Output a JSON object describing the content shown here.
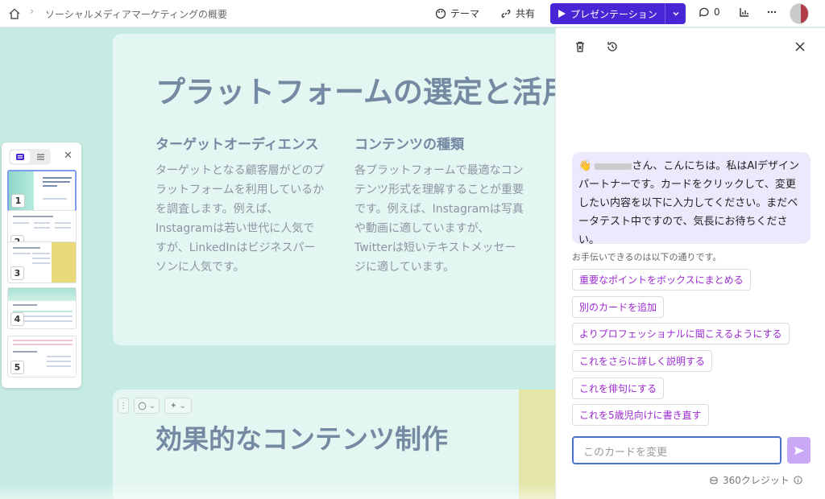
{
  "topbar": {
    "breadcrumb": "ソーシャルメディアマーケティングの概要",
    "theme_label": "テーマ",
    "share_label": "共有",
    "present_label": "プレゼンテーション",
    "comment_count": "0"
  },
  "slide1": {
    "title": "プラットフォームの選定と活用",
    "columns": [
      {
        "heading": "ターゲットオーディエンス",
        "body": "ターゲットとなる顧客層がどのプラットフォームを利用しているかを調査します。例えば、Instagramは若い世代に人気ですが、LinkedInはビジネスパーソンに人気です。"
      },
      {
        "heading": "コンテンツの種類",
        "body": "各プラットフォームで最適なコンテンツ形式を理解することが重要です。例えば、Instagramは写真や動画に適していますが、Twitterは短いテキストメッセージに適しています。"
      }
    ]
  },
  "slide2": {
    "title": "効果的なコンテンツ制作"
  },
  "thumbnails": [
    {
      "num": "1",
      "text": "ソーシャルメディアマーケティングの概要"
    },
    {
      "num": "2",
      "text": "プラットフォームの選定と活用"
    },
    {
      "num": "3",
      "text": "効果的なコンテンツ制作"
    },
    {
      "num": "4",
      "text": "分析と改善サイクル"
    },
    {
      "num": "5",
      "text": "予算と ROI の測定"
    }
  ],
  "ai_panel": {
    "greeting_suffix": "さん、こんにちは。私はAIデザインパートナーです。カードをクリックして、変更したい内容を以下に入力してください。まだベータテスト中ですので、気長にお待ちください。",
    "helper": "お手伝いできるのは以下の通りです。",
    "suggestions": [
      "重要なポイントをボックスにまとめる",
      "別のカードを追加",
      "よりプロフェッショナルに聞こえるようにする",
      "これをさらに詳しく説明する",
      "これを俳句にする",
      "これを5歳児向けに書き直す"
    ],
    "input_placeholder": "このカードを変更",
    "credits": "360クレジット"
  },
  "colors": {
    "accent": "#4826d6",
    "chip_text": "#9b2ad0",
    "canvas": "#c5ebe3",
    "card": "#e3f6f1",
    "title": "#7489a2"
  }
}
